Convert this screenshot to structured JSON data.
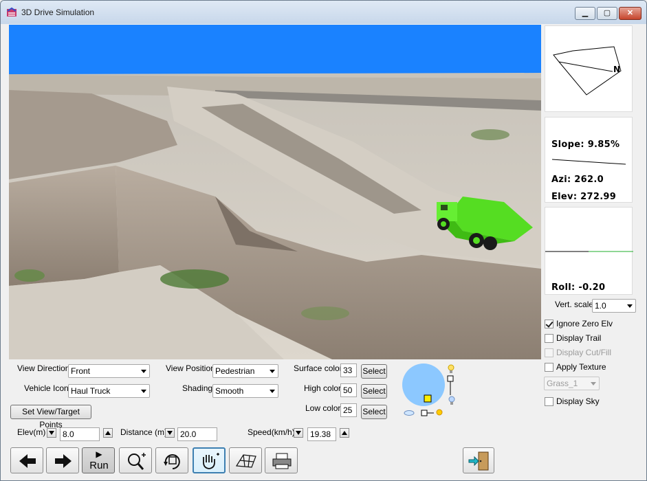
{
  "window": {
    "title": "3D Drive Simulation",
    "minimize": "▁",
    "maximize": "▢",
    "close": "✕"
  },
  "info": {
    "slope": "Slope: 9.85%",
    "azi": "Azi: 262.0",
    "elev": "Elev: 272.99",
    "roll": "Roll: -0.20",
    "compass_label": "N"
  },
  "vert_scale": {
    "label": "Vert. scale",
    "value": "1.0"
  },
  "checks": {
    "ignore_zero_elv": {
      "label": "Ignore Zero Elv",
      "checked": true
    },
    "display_trail": {
      "label": "Display Trail",
      "checked": false
    },
    "display_cut_fill": {
      "label": "Display Cut/Fill",
      "checked": false,
      "disabled": true
    },
    "apply_texture": {
      "label": "Apply Texture",
      "checked": false
    },
    "texture_select": "Grass_1",
    "display_sky": {
      "label": "Display Sky",
      "checked": false
    }
  },
  "controls": {
    "view_direction": {
      "label": "View Direction",
      "value": "Front"
    },
    "vehicle_icon": {
      "label": "Vehicle Icon",
      "value": "Haul Truck"
    },
    "view_position": {
      "label": "View Position",
      "value": "Pedestrian"
    },
    "shading": {
      "label": "Shading",
      "value": "Smooth"
    },
    "surface_color": {
      "label": "Surface color",
      "value": "33",
      "button": "Select"
    },
    "high_color": {
      "label": "High color",
      "value": "50",
      "button": "Select"
    },
    "low_color": {
      "label": "Low color",
      "value": "25",
      "button": "Select"
    },
    "set_view": "Set View/Target Points",
    "elev": {
      "label": "Elev(m)",
      "value": "8.0"
    },
    "distance": {
      "label": "Distance (m)",
      "value": "20.0"
    },
    "speed": {
      "label": "Speed(km/h)",
      "value": "19.38"
    }
  },
  "toolbar": {
    "run_label": "Run",
    "run_glyph": "▶",
    "back_icon": "arrow-left-icon",
    "forward_icon": "arrow-right-icon",
    "zoom_icon": "zoom-in-icon",
    "rotate_icon": "rotate-view-icon",
    "pan_icon": "pan-hand-icon",
    "mesh_icon": "wireframe-icon",
    "print_icon": "printer-icon",
    "exit_icon": "exit-door-icon"
  },
  "colors": {
    "sky": "#1a82ff",
    "truck": "#55dd22",
    "light_panel": "#8cc8ff",
    "marker": "#ffee00"
  }
}
